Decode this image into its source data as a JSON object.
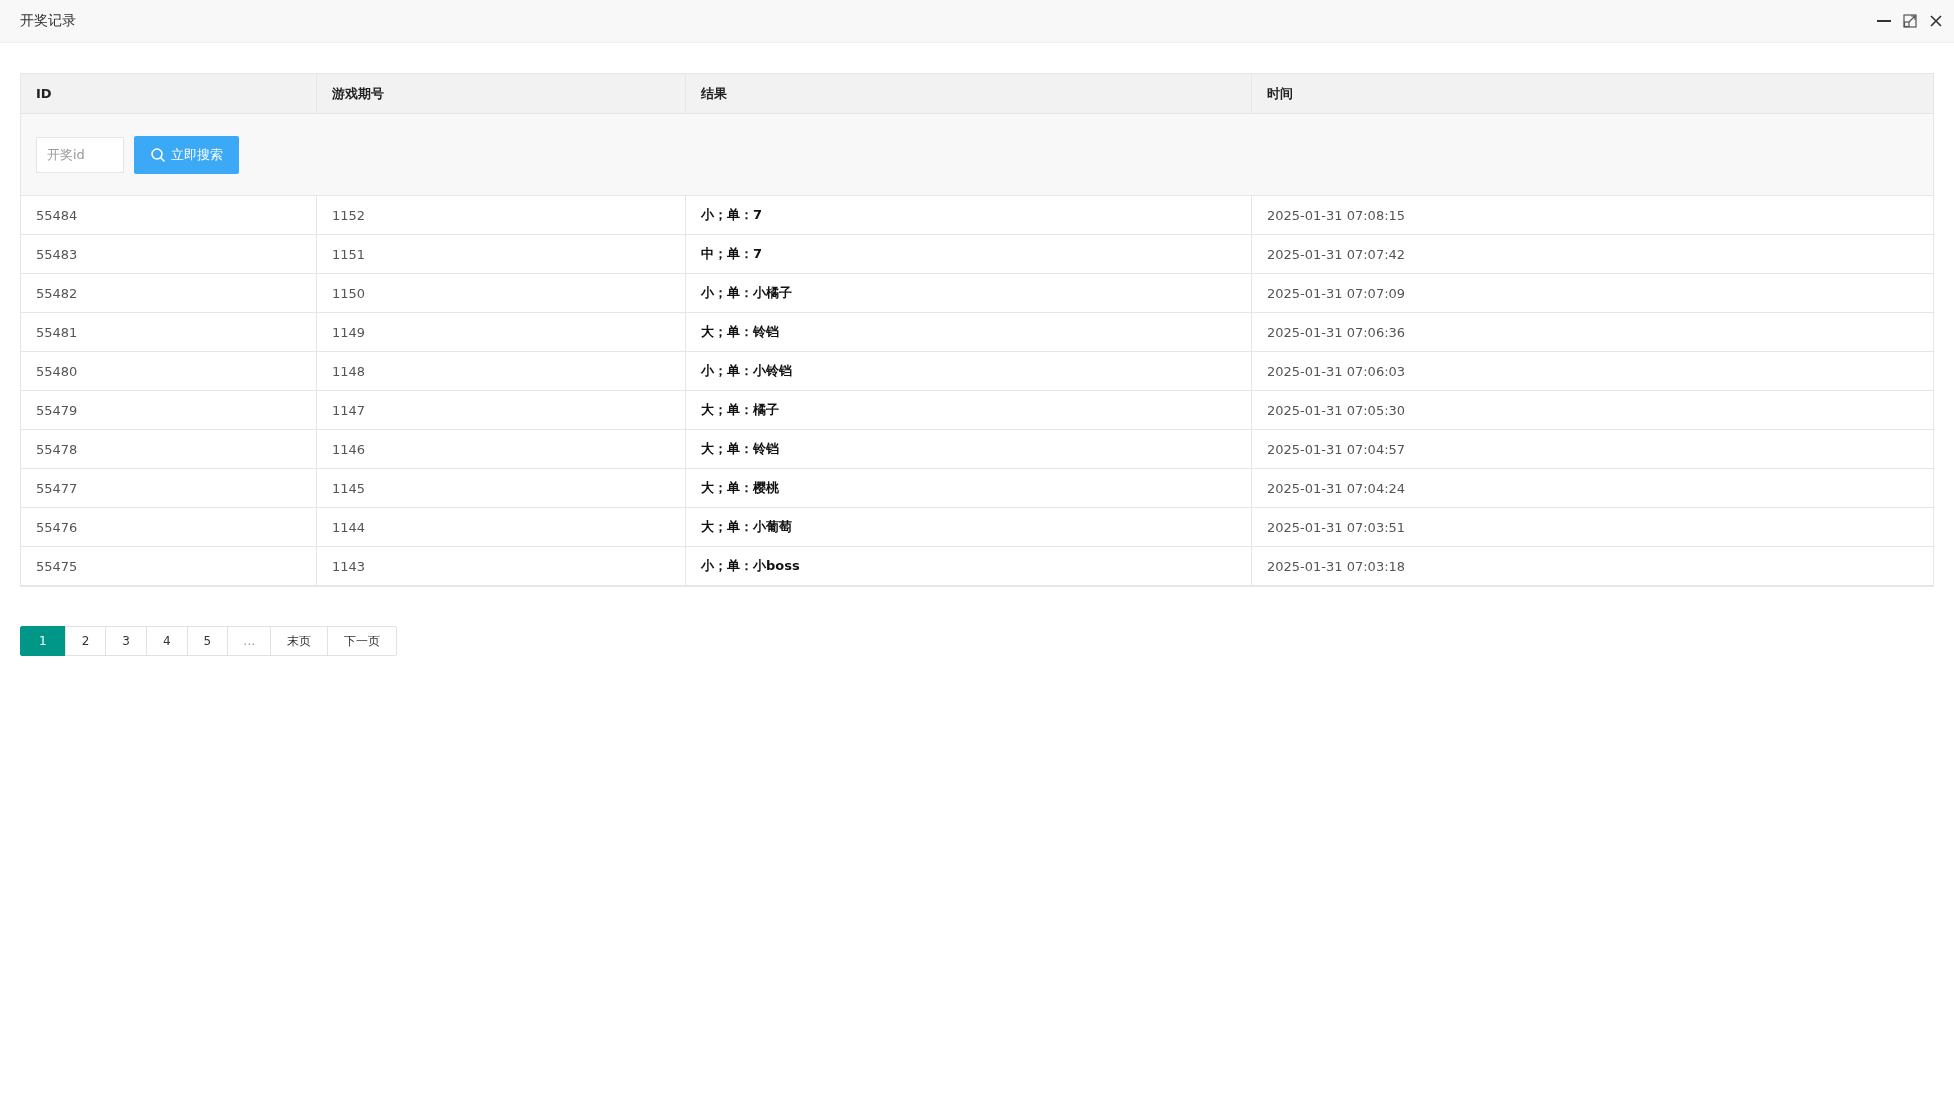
{
  "window": {
    "title": "开奖记录"
  },
  "table": {
    "columns": [
      "ID",
      "游戏期号",
      "结果",
      "时间"
    ],
    "search": {
      "placeholder": "开奖id",
      "button": "立即搜索"
    },
    "rows": [
      {
        "id": "55484",
        "period": "1152",
        "result": "小；单：7",
        "time": "2025-01-31 07:08:15"
      },
      {
        "id": "55483",
        "period": "1151",
        "result": "中；单：7",
        "time": "2025-01-31 07:07:42"
      },
      {
        "id": "55482",
        "period": "1150",
        "result": "小；单：小橘子",
        "time": "2025-01-31 07:07:09"
      },
      {
        "id": "55481",
        "period": "1149",
        "result": "大；单：铃铛",
        "time": "2025-01-31 07:06:36"
      },
      {
        "id": "55480",
        "period": "1148",
        "result": "小；单：小铃铛",
        "time": "2025-01-31 07:06:03"
      },
      {
        "id": "55479",
        "period": "1147",
        "result": "大；单：橘子",
        "time": "2025-01-31 07:05:30"
      },
      {
        "id": "55478",
        "period": "1146",
        "result": "大；单：铃铛",
        "time": "2025-01-31 07:04:57"
      },
      {
        "id": "55477",
        "period": "1145",
        "result": "大；单：樱桃",
        "time": "2025-01-31 07:04:24"
      },
      {
        "id": "55476",
        "period": "1144",
        "result": "大；单：小葡萄",
        "time": "2025-01-31 07:03:51"
      },
      {
        "id": "55475",
        "period": "1143",
        "result": "小；单：小boss",
        "time": "2025-01-31 07:03:18"
      }
    ]
  },
  "pagination": [
    {
      "label": "1",
      "selected": true,
      "kind": "page"
    },
    {
      "label": "2",
      "selected": false,
      "kind": "page"
    },
    {
      "label": "3",
      "selected": false,
      "kind": "page"
    },
    {
      "label": "4",
      "selected": false,
      "kind": "page"
    },
    {
      "label": "5",
      "selected": false,
      "kind": "page"
    },
    {
      "label": "…",
      "kind": "gap"
    },
    {
      "label": "末页",
      "selected": false,
      "kind": "page"
    },
    {
      "label": "下一页",
      "selected": false,
      "kind": "page"
    }
  ]
}
